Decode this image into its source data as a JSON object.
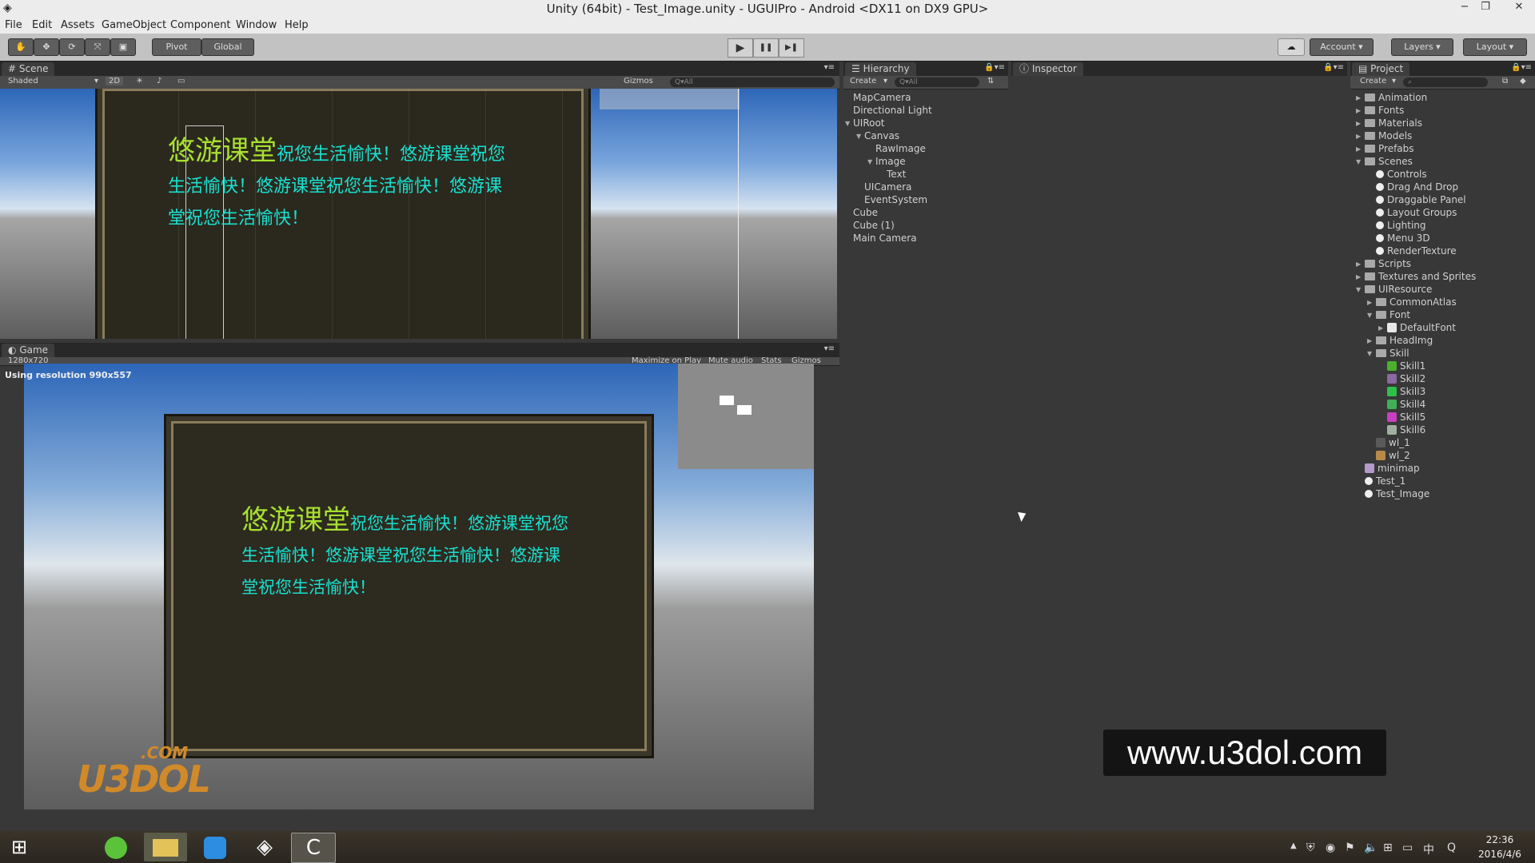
{
  "window": {
    "title": "Unity (64bit) - Test_Image.unity - UGUIPro - Android <DX11 on DX9 GPU>",
    "minimize": "−",
    "restore": "❐",
    "close": "✕"
  },
  "menu": [
    "File",
    "Edit",
    "Assets",
    "GameObject",
    "Component",
    "Window",
    "Help"
  ],
  "toolbar": {
    "pivot": "Pivot",
    "global": "Global",
    "play": "▶",
    "pause": "❚❚",
    "step": "▶❚",
    "account": "Account",
    "layers": "Layers",
    "layout": "Layout"
  },
  "scene": {
    "tab": "Scene",
    "shading": "Shaded",
    "mode2d": "2D",
    "gizmos": "Gizmos",
    "search_placeholder": "Q▾All"
  },
  "game": {
    "tab": "Game",
    "resolution": "1280x720",
    "resolution_notice": "Using resolution 990x557",
    "maximize": "Maximize on Play",
    "mute": "Mute audio",
    "stats": "Stats",
    "gizmos": "Gizmos"
  },
  "ui_text": {
    "line1_big": "悠游课堂",
    "line1_small": "祝您生活愉快！悠游课堂祝您",
    "line2": "生活愉快！悠游课堂祝您生活愉快！悠游课",
    "line3": "堂祝您生活愉快！"
  },
  "hierarchy": {
    "tab": "Hierarchy",
    "create": "Create",
    "search_placeholder": "Q▾All",
    "items": [
      {
        "label": "MapCamera",
        "depth": 0,
        "expanded": null
      },
      {
        "label": "Directional Light",
        "depth": 0,
        "expanded": null
      },
      {
        "label": "UIRoot",
        "depth": 0,
        "expanded": true
      },
      {
        "label": "Canvas",
        "depth": 1,
        "expanded": true
      },
      {
        "label": "RawImage",
        "depth": 2,
        "expanded": null
      },
      {
        "label": "Image",
        "depth": 2,
        "expanded": true
      },
      {
        "label": "Text",
        "depth": 3,
        "expanded": null
      },
      {
        "label": "UICamera",
        "depth": 1,
        "expanded": null
      },
      {
        "label": "EventSystem",
        "depth": 1,
        "expanded": null
      },
      {
        "label": "Cube",
        "depth": 0,
        "expanded": null
      },
      {
        "label": "Cube (1)",
        "depth": 0,
        "expanded": null
      },
      {
        "label": "Main Camera",
        "depth": 0,
        "expanded": null
      }
    ]
  },
  "inspector": {
    "tab": "Inspector"
  },
  "project": {
    "tab": "Project",
    "create": "Create",
    "items": [
      {
        "label": "Animation",
        "depth": 0,
        "kind": "folder",
        "expanded": false
      },
      {
        "label": "Fonts",
        "depth": 0,
        "kind": "folder",
        "expanded": false
      },
      {
        "label": "Materials",
        "depth": 0,
        "kind": "folder",
        "expanded": false
      },
      {
        "label": "Models",
        "depth": 0,
        "kind": "folder",
        "expanded": false
      },
      {
        "label": "Prefabs",
        "depth": 0,
        "kind": "folder",
        "expanded": false
      },
      {
        "label": "Scenes",
        "depth": 0,
        "kind": "folder",
        "expanded": true
      },
      {
        "label": "Controls",
        "depth": 1,
        "kind": "scene",
        "expanded": null
      },
      {
        "label": "Drag And Drop",
        "depth": 1,
        "kind": "scene",
        "expanded": null
      },
      {
        "label": "Draggable Panel",
        "depth": 1,
        "kind": "scene",
        "expanded": null
      },
      {
        "label": "Layout Groups",
        "depth": 1,
        "kind": "scene",
        "expanded": null
      },
      {
        "label": "Lighting",
        "depth": 1,
        "kind": "scene",
        "expanded": null
      },
      {
        "label": "Menu 3D",
        "depth": 1,
        "kind": "scene",
        "expanded": null
      },
      {
        "label": "RenderTexture",
        "depth": 1,
        "kind": "scene",
        "expanded": null
      },
      {
        "label": "Scripts",
        "depth": 0,
        "kind": "folder",
        "expanded": false
      },
      {
        "label": "Textures and Sprites",
        "depth": 0,
        "kind": "folder",
        "expanded": false
      },
      {
        "label": "UIResource",
        "depth": 0,
        "kind": "folder",
        "expanded": true
      },
      {
        "label": "CommonAtlas",
        "depth": 1,
        "kind": "folder",
        "expanded": false
      },
      {
        "label": "Font",
        "depth": 1,
        "kind": "folder",
        "expanded": true
      },
      {
        "label": "DefaultFont",
        "depth": 2,
        "kind": "font",
        "expanded": false
      },
      {
        "label": "HeadImg",
        "depth": 1,
        "kind": "folder",
        "expanded": false
      },
      {
        "label": "Skill",
        "depth": 1,
        "kind": "folder",
        "expanded": true
      },
      {
        "label": "Skill1",
        "depth": 2,
        "kind": "skill",
        "expanded": null
      },
      {
        "label": "Skill2",
        "depth": 2,
        "kind": "skill",
        "expanded": null
      },
      {
        "label": "Skill3",
        "depth": 2,
        "kind": "skill",
        "expanded": null
      },
      {
        "label": "Skill4",
        "depth": 2,
        "kind": "skill",
        "expanded": null
      },
      {
        "label": "Skill5",
        "depth": 2,
        "kind": "skill",
        "expanded": null
      },
      {
        "label": "Skill6",
        "depth": 2,
        "kind": "skill",
        "expanded": null
      },
      {
        "label": "wl_1",
        "depth": 1,
        "kind": "texture",
        "expanded": null
      },
      {
        "label": "wl_2",
        "depth": 1,
        "kind": "texture",
        "expanded": null
      },
      {
        "label": "minimap",
        "depth": 0,
        "kind": "rendertexture",
        "expanded": null
      },
      {
        "label": "Test_1",
        "depth": 0,
        "kind": "scene",
        "expanded": null
      },
      {
        "label": "Test_Image",
        "depth": 0,
        "kind": "scene",
        "expanded": null
      }
    ]
  },
  "watermark": {
    "url": "www.u3dol.com",
    "logo_text": "U3DOL",
    "logo_dotcom": ".COM"
  },
  "taskbar": {
    "time": "22:36",
    "date": "2016/4/6"
  },
  "colors": {
    "text_green": "#a7e02f",
    "text_cyan": "#19e0d0",
    "panel_bg": "#383838",
    "tab_bg": "#282828"
  }
}
